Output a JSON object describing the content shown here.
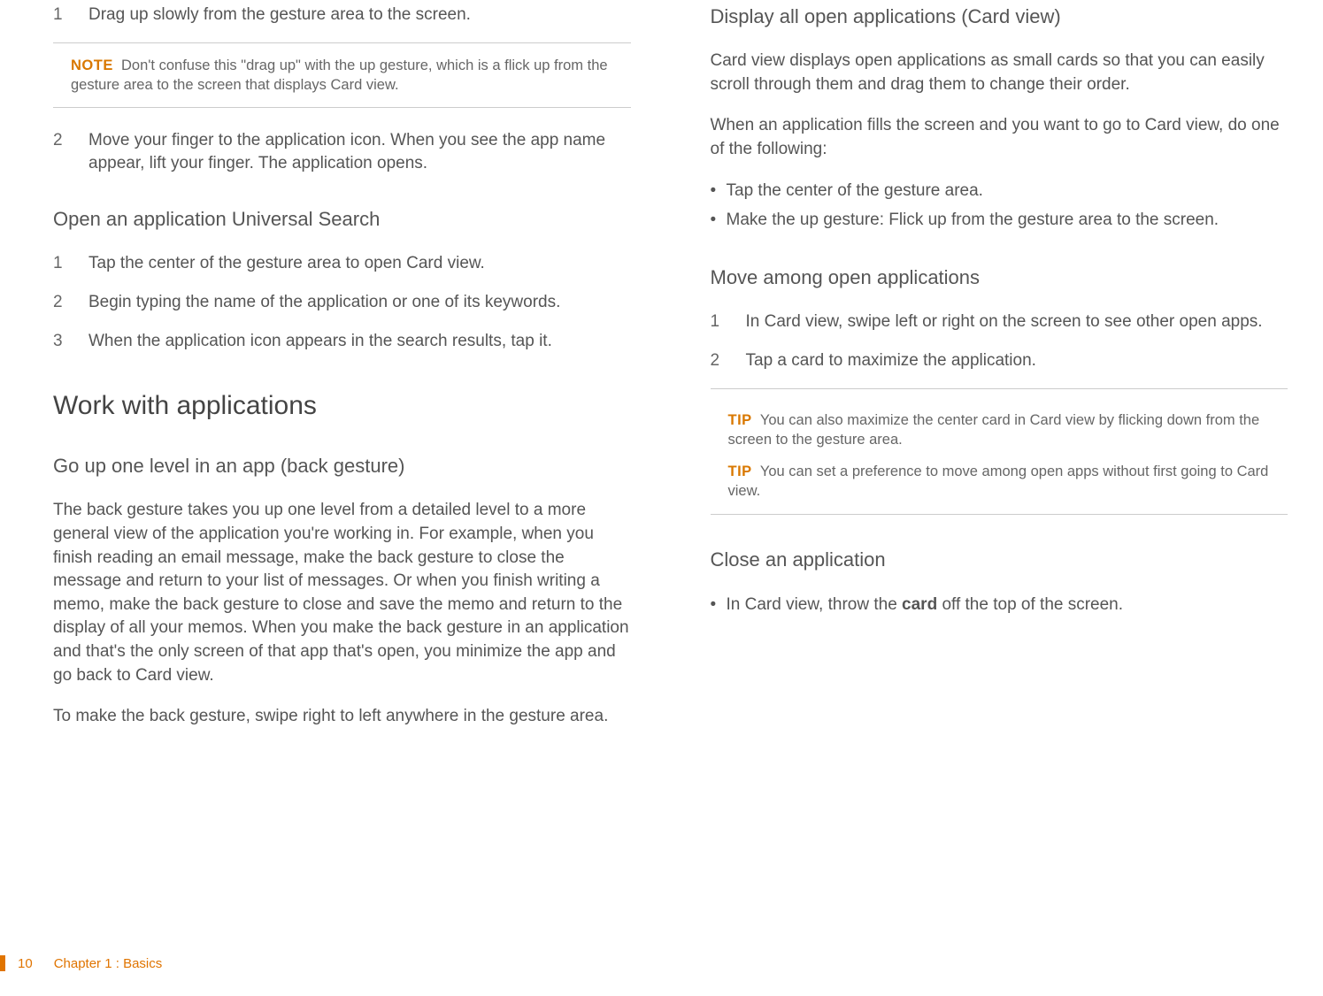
{
  "left": {
    "step1": {
      "num": "1",
      "text": "Drag up slowly from the gesture area to the screen."
    },
    "note": {
      "label": "NOTE",
      "text": "Don't confuse this \"drag up\" with the up gesture, which is a flick up from the gesture area to the screen that displays Card view."
    },
    "step2": {
      "num": "2",
      "text": "Move your finger to the application icon. When you see the app name appear, lift your finger. The application opens."
    },
    "h3a": "Open an application Universal Search",
    "us1": {
      "num": "1",
      "text": "Tap the center of the gesture area to open Card view."
    },
    "us2": {
      "num": "2",
      "text": "Begin typing the name of the application or one of its keywords."
    },
    "us3": {
      "num": "3",
      "text": "When the application icon appears in the search results, tap it."
    },
    "h2a": "Work with applications",
    "h3b": "Go up one level in an app (back gesture)",
    "back_para": "The back gesture takes you up one level from a detailed level to a more general view of the application you're working in. For example, when you finish reading an email message, make the back gesture to close the message and return to your list of messages. Or when you finish writing a memo, make the back gesture to close and save the memo and return to the display of all your memos. When you make the back gesture in an application and that's the only screen of that app that's open, you minimize the app and go back to Card view.",
    "back_para2": "To make the back gesture, swipe right to left anywhere in the gesture area."
  },
  "right": {
    "h3a": "Display all open applications (Card view)",
    "para1": "Card view displays open applications as small cards so that you can easily scroll through them and drag them to change their order.",
    "para2": "When an application fills the screen and you want to go to Card view, do one of the following:",
    "b1": "Tap the center of the gesture area.",
    "b2": "Make the up gesture: Flick up from the gesture area to the screen.",
    "h3b": "Move among open applications",
    "m1": {
      "num": "1",
      "text": "In Card view, swipe left or right on the screen to see other open apps."
    },
    "m2": {
      "num": "2",
      "text": "Tap a card to maximize the application."
    },
    "tip1": {
      "label": "TIP",
      "text": "You can also maximize the center card in Card view by flicking down from the screen to the gesture area."
    },
    "tip2": {
      "label": "TIP",
      "text": "You can set a preference to move among open apps without first going to Card view."
    },
    "h3c": "Close an application",
    "close_pre": "In Card view, throw the ",
    "close_bold": "card",
    "close_post": " off the top of the screen."
  },
  "footer": {
    "pagenum": "10",
    "chapter": "Chapter 1  :  Basics"
  }
}
